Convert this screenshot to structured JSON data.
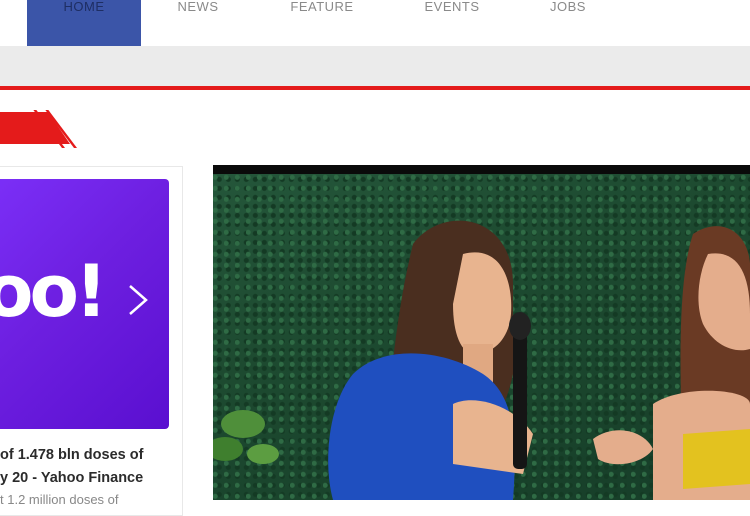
{
  "nav": {
    "items": [
      {
        "label": "HOME",
        "active": true
      },
      {
        "label": "NEWS",
        "active": false
      },
      {
        "label": "FEATURE",
        "active": false
      },
      {
        "label": "EVENTS",
        "active": false
      },
      {
        "label": "JOBS",
        "active": false
      }
    ]
  },
  "colors": {
    "accent_red": "#e41b1b",
    "nav_active_bg": "#3b55a8",
    "yahoo_purple": "#6d1fe0"
  },
  "card": {
    "logo_text": "oo!",
    "title_line1": "of 1.478 bln doses of",
    "title_line2": "y 20 - Yahoo Finance",
    "excerpt": "t 1.2 million doses of",
    "icon": "chevron-right-icon"
  },
  "video": {
    "description": "Interview video: woman in blue top holding microphone talking with woman in yellow top in front of a green hedge wall"
  }
}
